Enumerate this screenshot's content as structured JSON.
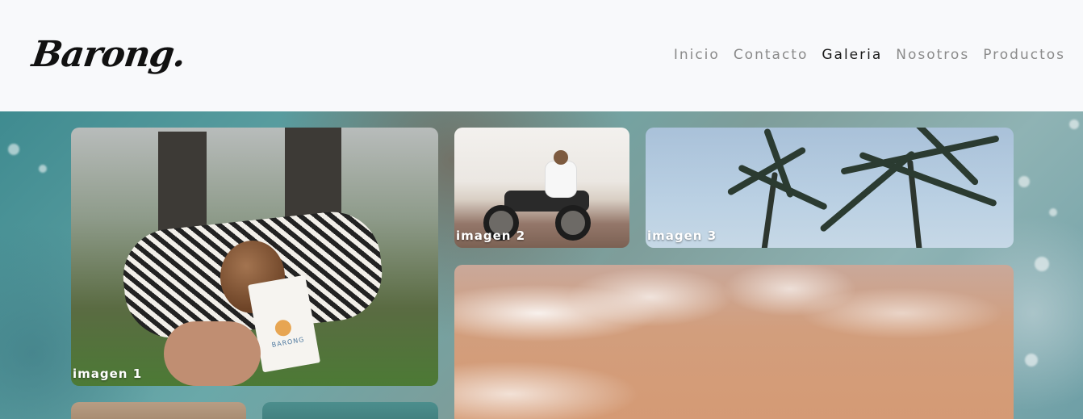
{
  "header": {
    "logo": "Barong.",
    "nav": [
      {
        "label": "Inicio",
        "active": false
      },
      {
        "label": "Contacto",
        "active": false
      },
      {
        "label": "Galeria",
        "active": true
      },
      {
        "label": "Nosotros",
        "active": false
      },
      {
        "label": "Productos",
        "active": false
      }
    ]
  },
  "gallery": {
    "images": [
      {
        "caption": "imagen 1"
      },
      {
        "caption": "imagen 2"
      },
      {
        "caption": "imagen 3"
      },
      {
        "caption": ""
      },
      {
        "caption": ""
      },
      {
        "caption": ""
      }
    ],
    "tag_brand": "BARONG"
  },
  "colors": {
    "header_bg": "#f8f9fb",
    "nav_text": "#8a8a8a",
    "nav_active": "#1b1b1b",
    "caption_text": "#ffffff"
  }
}
